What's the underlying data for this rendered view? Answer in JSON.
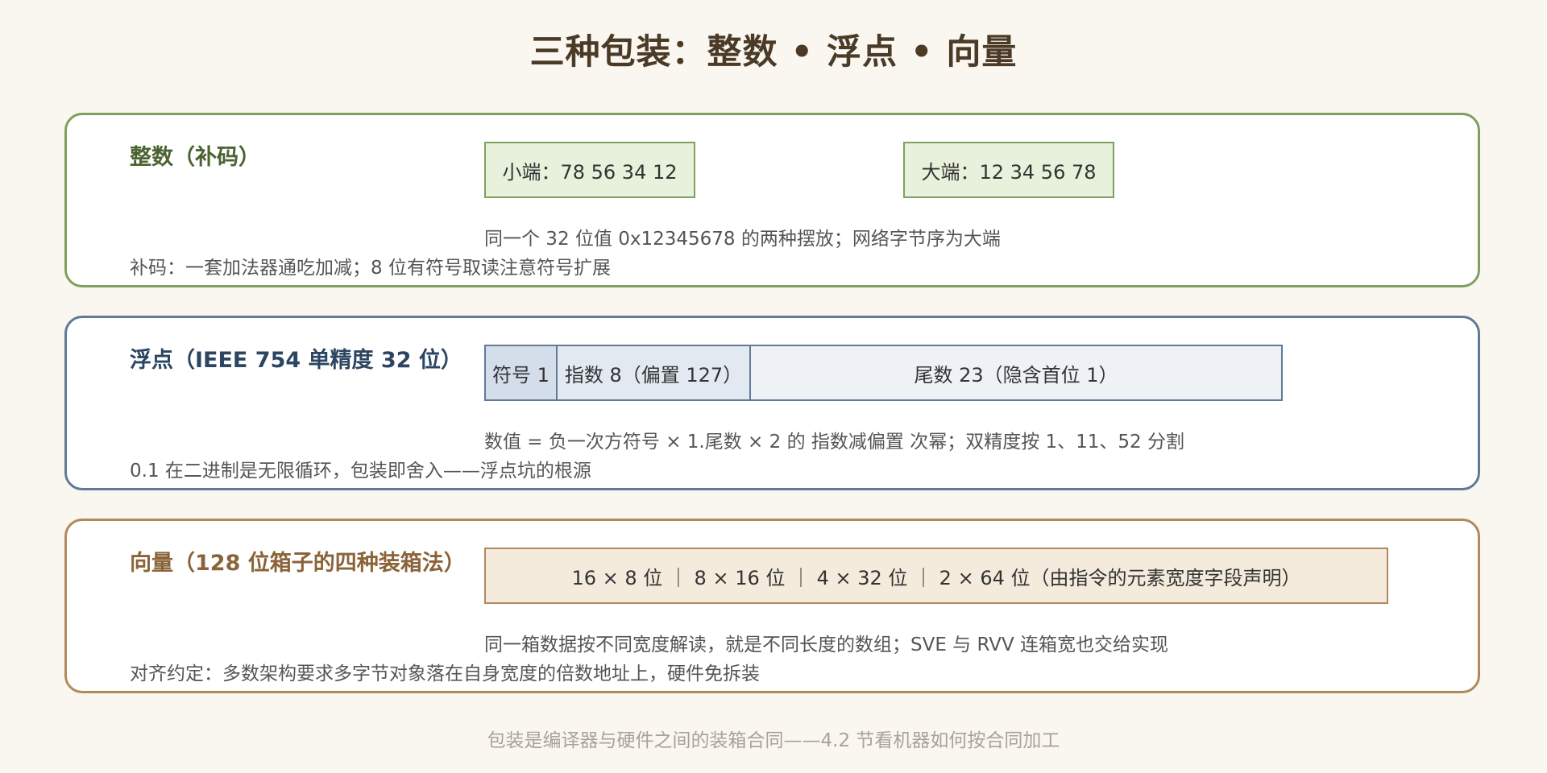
{
  "title": "三种包装：整数 • 浮点 • 向量",
  "integer": {
    "title": "整数（补码）",
    "little_endian": "小端：78 56 34 12",
    "big_endian": "大端：12 34 56 78",
    "line1": "同一个 32 位值 0x12345678 的两种摆放；网络字节序为大端",
    "line2": "补码：一套加法器通吃加减；8 位有符号取读注意符号扩展"
  },
  "float": {
    "title": "浮点（IEEE 754 单精度 32 位）",
    "sign": "符号 1",
    "exponent": "指数 8（偏置 127）",
    "mantissa": "尾数 23（隐含首位 1）",
    "line1": "数值 = 负一次方符号 × 1.尾数 × 2 的 指数减偏置 次幂；双精度按 1、11、52 分割",
    "line2": "0.1 在二进制是无限循环，包装即舍入——浮点坑的根源"
  },
  "vector": {
    "title": "向量（128 位箱子的四种装箱法）",
    "layouts": "16 × 8 位 ｜ 8 × 16 位 ｜ 4 × 32 位 ｜ 2 × 64 位（由指令的元素宽度字段声明）",
    "line1": "同一箱数据按不同宽度解读，就是不同长度的数组；SVE 与 RVV 连箱宽也交给实现",
    "line2": "对齐约定：多数架构要求多字节对象落在自身宽度的倍数地址上，硬件免拆装"
  },
  "footer": "包装是编译器与硬件之间的装箱合同——4.2 节看机器如何按合同加工",
  "colors": {
    "integer_accent": "#7fa05e",
    "float_accent": "#607a97",
    "vector_accent": "#b08a5c",
    "background": "#faf6f0"
  }
}
